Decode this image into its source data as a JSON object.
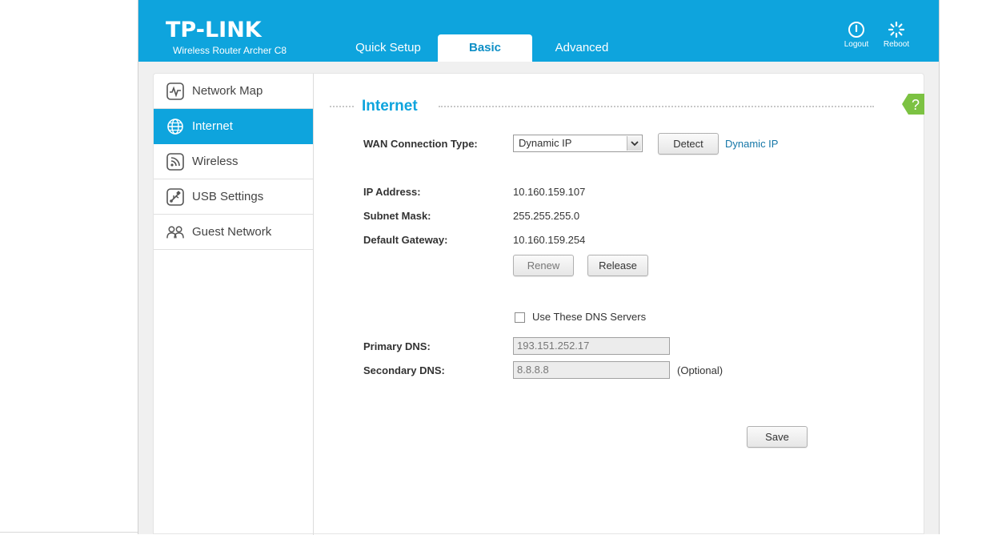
{
  "header": {
    "logo": "TP-LINK",
    "model": "Wireless Router Archer C8",
    "tabs": [
      {
        "label": "Quick Setup"
      },
      {
        "label": "Basic"
      },
      {
        "label": "Advanced"
      }
    ],
    "logout_label": "Logout",
    "reboot_label": "Reboot"
  },
  "sidebar": {
    "items": [
      {
        "label": "Network Map",
        "icon": "network-map-icon"
      },
      {
        "label": "Internet",
        "icon": "globe-icon"
      },
      {
        "label": "Wireless",
        "icon": "wireless-icon"
      },
      {
        "label": "USB Settings",
        "icon": "usb-icon"
      },
      {
        "label": "Guest Network",
        "icon": "guest-users-icon"
      }
    ]
  },
  "main": {
    "title": "Internet",
    "help_glyph": "?",
    "wan_label": "WAN Connection Type:",
    "wan_value": "Dynamic IP",
    "detect_label": "Detect",
    "detect_result": "Dynamic IP",
    "ip_label": "IP Address:",
    "ip_value": "10.160.159.107",
    "mask_label": "Subnet Mask:",
    "mask_value": "255.255.255.0",
    "gateway_label": "Default Gateway:",
    "gateway_value": "10.160.159.254",
    "renew_label": "Renew",
    "release_label": "Release",
    "dns_checkbox_label": "Use These DNS Servers",
    "primary_dns_label": "Primary DNS:",
    "primary_dns_value": "193.151.252.17",
    "secondary_dns_label": "Secondary DNS:",
    "secondary_dns_value": "8.8.8.8",
    "optional_label": "(Optional)",
    "save_label": "Save"
  },
  "colors": {
    "brand_blue": "#0ea4dd",
    "help_green": "#7cc242",
    "link_blue": "#1577a8"
  }
}
